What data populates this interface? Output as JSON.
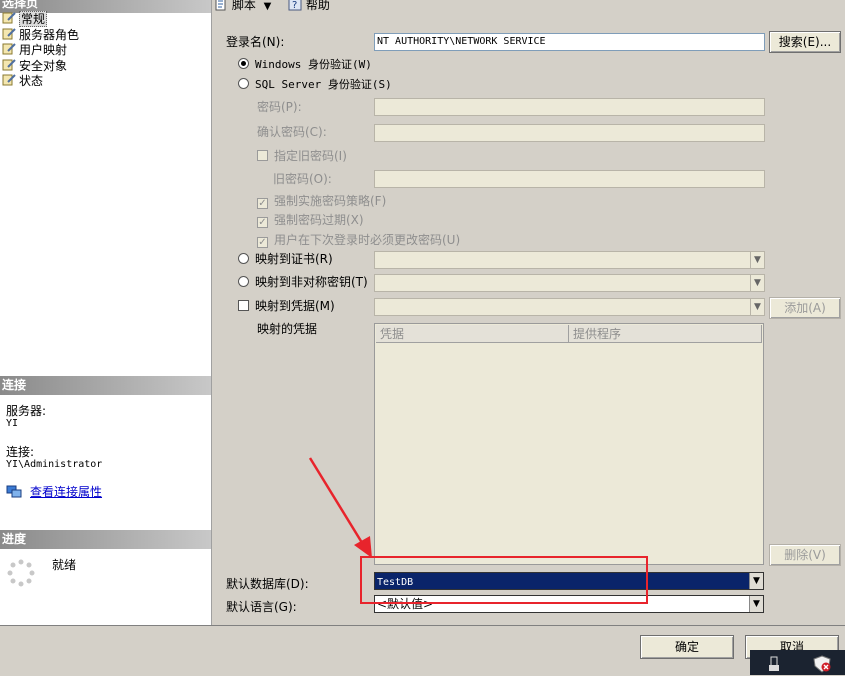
{
  "left_pane": {
    "select_page_header": "选择页",
    "nav_items": [
      {
        "label": "常规",
        "icon": "page-wrench-icon",
        "selected": true
      },
      {
        "label": "服务器角色",
        "icon": "page-wrench-icon"
      },
      {
        "label": "用户映射",
        "icon": "page-wrench-icon"
      },
      {
        "label": "安全对象",
        "icon": "page-wrench-icon"
      },
      {
        "label": "状态",
        "icon": "page-wrench-icon"
      }
    ],
    "connection_header": "连接",
    "server_label": "服务器:",
    "server_value": "YI",
    "connection_label": "连接:",
    "connection_value": "YI\\Administrator",
    "view_connection_props_link": "查看连接属性",
    "progress_header": "进度",
    "progress_status": "就绪"
  },
  "toolbar": {
    "script_label": "脚本",
    "help_label": "帮助"
  },
  "form": {
    "login_name_label": "登录名(N):",
    "login_name_value": "NT AUTHORITY\\NETWORK SERVICE",
    "search_button": "搜索(E)...",
    "windows_auth_label": "Windows 身份验证(W)",
    "sql_auth_label": "SQL Server 身份验证(S)",
    "password_label": "密码(P):",
    "confirm_password_label": "确认密码(C):",
    "specify_old_password_label": "指定旧密码(I)",
    "old_password_label": "旧密码(O):",
    "enforce_policy_label": "强制实施密码策略(F)",
    "enforce_expiration_label": "强制密码过期(X)",
    "must_change_label": "用户在下次登录时必须更改密码(U)",
    "map_certificate_label": "映射到证书(R)",
    "map_asymmetric_key_label": "映射到非对称密钥(T)",
    "map_credential_label": "映射到凭据(M)",
    "add_button": "添加(A)",
    "mapped_credentials_label": "映射的凭据",
    "grid_columns": [
      "凭据",
      "提供程序"
    ],
    "remove_button": "删除(V)",
    "default_database_label": "默认数据库(D):",
    "default_database_value": "TestDB",
    "default_language_label": "默认语言(G):",
    "default_language_value": "<默认值>"
  },
  "footer": {
    "ok_button": "确定",
    "cancel_button": "取消"
  },
  "colors": {
    "annotation": "#e8242c",
    "selection": "#0a246a",
    "link": "#0000cc"
  }
}
